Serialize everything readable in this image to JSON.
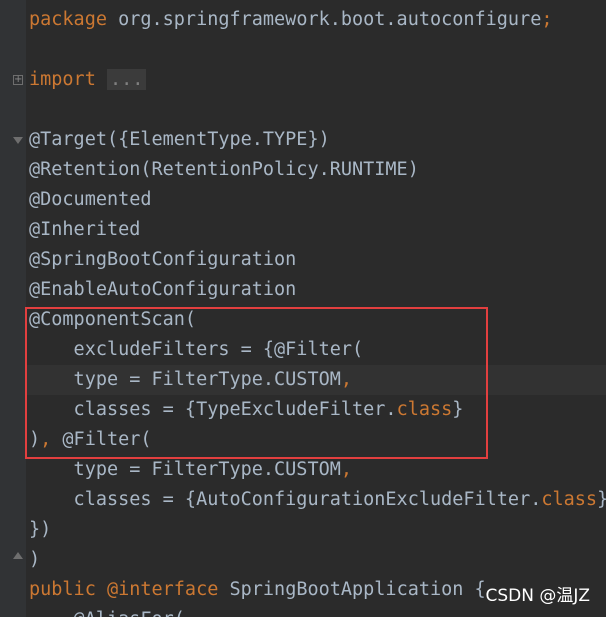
{
  "package_line": {
    "keyword": "package",
    "name": "org.springframework.boot.autoconfigure",
    "terminator": ";"
  },
  "import_line": {
    "keyword": "import",
    "collapsed": "..."
  },
  "annotations": {
    "target": "@Target({ElementType.TYPE})",
    "retention": "@Retention(RetentionPolicy.RUNTIME)",
    "documented": "@Documented",
    "inherited": "@Inherited",
    "spring_boot_configuration": "@SpringBootConfiguration",
    "enable_auto_configuration": "@EnableAutoConfiguration",
    "component_scan": "@ComponentScan("
  },
  "component_scan": {
    "exclude_filters": "    excludeFilters = {@Filter(",
    "type_1_text": "    type = FilterType.CUSTOM",
    "type_1_comma": ",",
    "classes_1_prefix": "    classes = {TypeExcludeFilter.",
    "classes_1_keyword": "class",
    "classes_1_suffix": "}",
    "close_1_paren": ")",
    "close_1_rest": ", ",
    "filter_2": "@Filter(",
    "type_2_text": "    type = FilterType.CUSTOM",
    "type_2_comma": ",",
    "classes_2_prefix": "    classes = {AutoConfigurationExcludeFilter.",
    "classes_2_keyword": "class",
    "classes_2_suffix": "}",
    "close_braces": "})",
    "close_paren": ")"
  },
  "declaration": {
    "modifier": "public",
    "interface_keyword": "@interface",
    "name": "SpringBootApplication",
    "brace": "{"
  },
  "last_line": "    @AliasFor(",
  "watermark": "CSDN @温JZ",
  "colors": {
    "background": "#2b2b2b",
    "keyword": "#cc7832",
    "text": "#a9b7c6",
    "highlight_box": "#e23f3f"
  }
}
